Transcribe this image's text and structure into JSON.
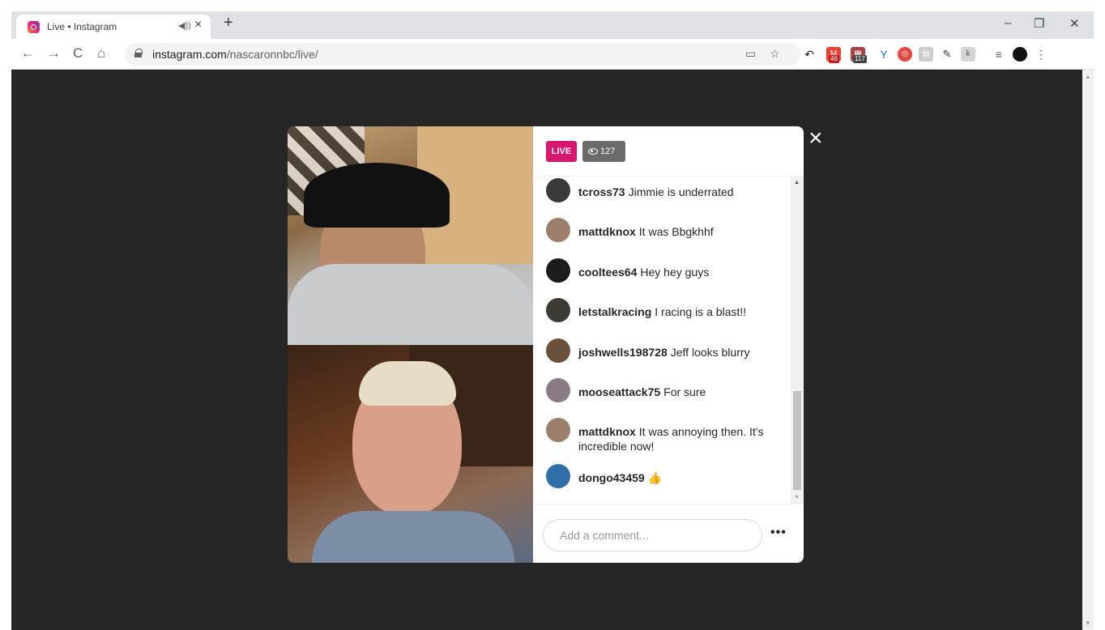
{
  "browser": {
    "tab_title": "Live • Instagram",
    "tab_audio_icon": "speaker-icon",
    "tab_close": "×",
    "new_tab": "+",
    "window_minimize": "–",
    "window_restore": "❐",
    "window_close": "✕",
    "url_host": "instagram.com",
    "url_path": "/nascaronnbc/live/",
    "extensions": [
      {
        "name": "mail-extension",
        "badge": "46"
      },
      {
        "name": "calendar-extension",
        "badge": "117"
      }
    ]
  },
  "live": {
    "live_label": "LIVE",
    "viewer_count": "127",
    "close_label": "×",
    "comments": [
      {
        "user": "tcross73",
        "text": "Jimmie is underrated",
        "avatar_color": "#3a3a3a"
      },
      {
        "user": "mattdknox",
        "text": "It was Bbgkhhf",
        "avatar_color": "#9c7f6a"
      },
      {
        "user": "cooltees64",
        "text": "Hey hey guys",
        "avatar_color": "#1c1c1c"
      },
      {
        "user": "letstalkracing",
        "text": "I racing is a blast!!",
        "avatar_color": "#3d3a36"
      },
      {
        "user": "joshwells198728",
        "text": "Jeff looks blurry",
        "avatar_color": "#6a5038"
      },
      {
        "user": "mooseattack75",
        "text": "For sure",
        "avatar_color": "#8a7a86"
      },
      {
        "user": "mattdknox",
        "text": "It was annoying then. It's incredible now!",
        "avatar_color": "#9c7f6a"
      },
      {
        "user": "dongo43459",
        "text": "👍",
        "avatar_color": "#2f6fa8"
      }
    ],
    "comment_placeholder": "Add a comment...",
    "more_options": "•••"
  }
}
